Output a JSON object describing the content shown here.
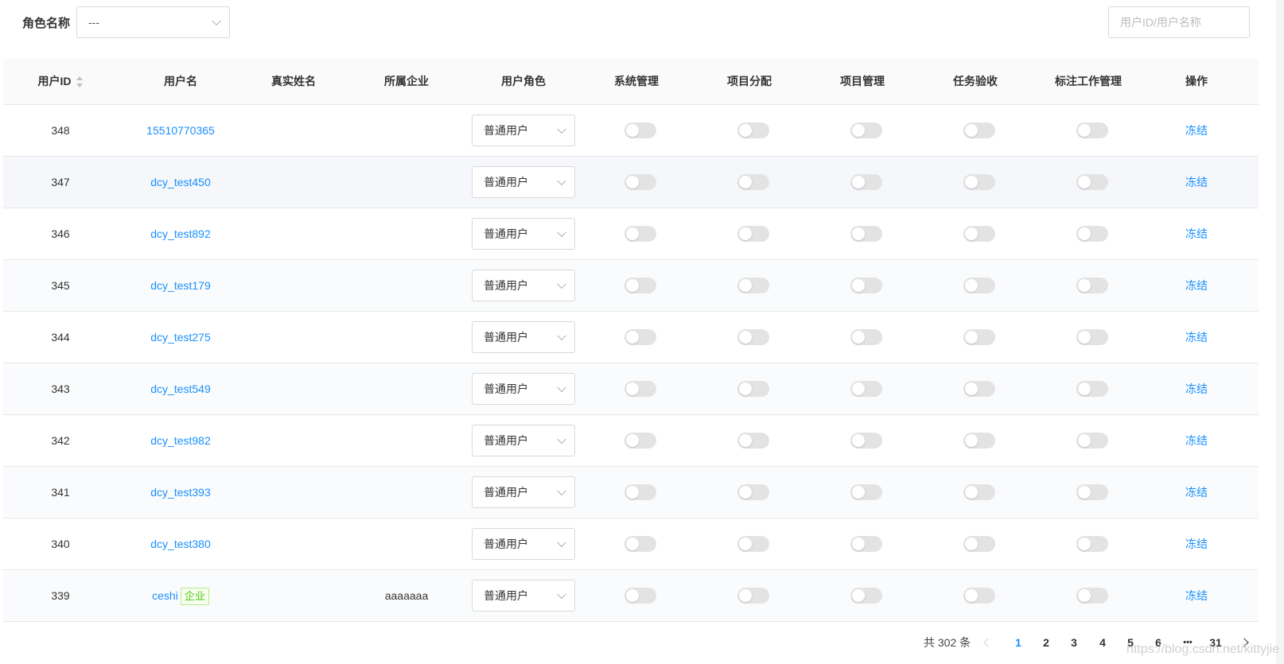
{
  "filter": {
    "role_label": "角色名称",
    "role_value": "---",
    "search_placeholder": "用户ID/用户名称",
    "search_value": ""
  },
  "table": {
    "columns": {
      "user_id": "用户ID",
      "username": "用户名",
      "real_name": "真实姓名",
      "company": "所属企业",
      "role": "用户角色",
      "sys_manage": "系统管理",
      "project_assign": "项目分配",
      "project_manage": "项目管理",
      "task_accept": "任务验收",
      "label_manage": "标注工作管理",
      "action": "操作"
    },
    "rows": [
      {
        "id": "348",
        "username": "15510770365",
        "tag": "",
        "real_name": "",
        "company": "",
        "role": "普通用户",
        "action": "冻结"
      },
      {
        "id": "347",
        "username": "dcy_test450",
        "tag": "",
        "real_name": "",
        "company": "",
        "role": "普通用户",
        "action": "冻结"
      },
      {
        "id": "346",
        "username": "dcy_test892",
        "tag": "",
        "real_name": "",
        "company": "",
        "role": "普通用户",
        "action": "冻结"
      },
      {
        "id": "345",
        "username": "dcy_test179",
        "tag": "",
        "real_name": "",
        "company": "",
        "role": "普通用户",
        "action": "冻结"
      },
      {
        "id": "344",
        "username": "dcy_test275",
        "tag": "",
        "real_name": "",
        "company": "",
        "role": "普通用户",
        "action": "冻结"
      },
      {
        "id": "343",
        "username": "dcy_test549",
        "tag": "",
        "real_name": "",
        "company": "",
        "role": "普通用户",
        "action": "冻结"
      },
      {
        "id": "342",
        "username": "dcy_test982",
        "tag": "",
        "real_name": "",
        "company": "",
        "role": "普通用户",
        "action": "冻结"
      },
      {
        "id": "341",
        "username": "dcy_test393",
        "tag": "",
        "real_name": "",
        "company": "",
        "role": "普通用户",
        "action": "冻结"
      },
      {
        "id": "340",
        "username": "dcy_test380",
        "tag": "",
        "real_name": "",
        "company": "",
        "role": "普通用户",
        "action": "冻结"
      },
      {
        "id": "339",
        "username": "ceshi",
        "tag": "企业",
        "real_name": "",
        "company": "aaaaaaa",
        "role": "普通用户",
        "action": "冻结"
      }
    ]
  },
  "pagination": {
    "total_text": "共 302 条",
    "pages": [
      "1",
      "2",
      "3",
      "4",
      "5",
      "6",
      "•••",
      "31"
    ],
    "current_page": "1"
  },
  "watermark": "https://blog.csdn.net/kittyjie",
  "colors": {
    "link": "#1890ff",
    "tag_green": "#52c41a",
    "switch_off": "#e3e3e3"
  }
}
